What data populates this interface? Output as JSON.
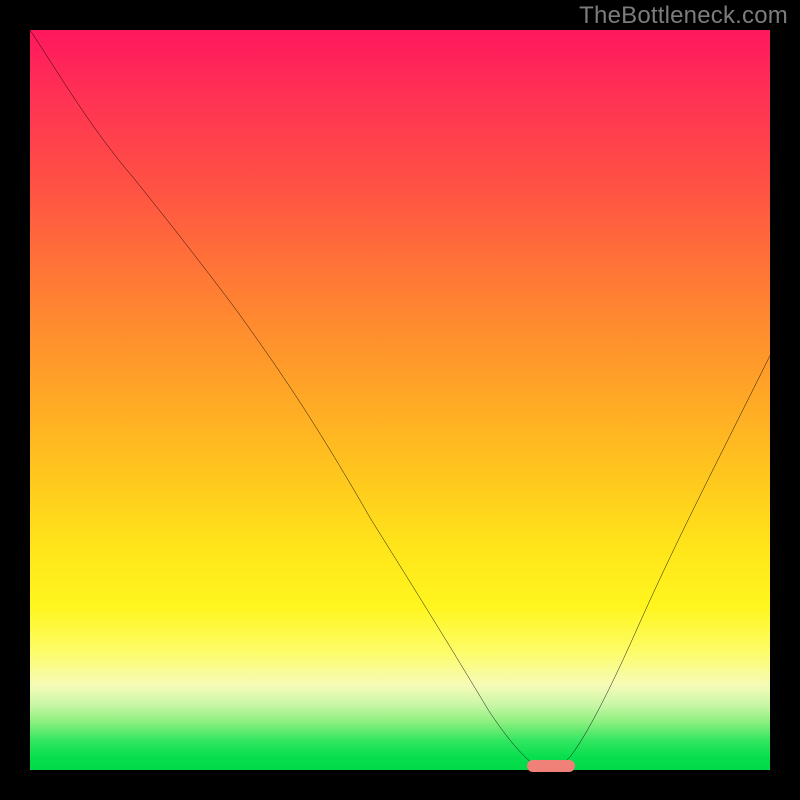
{
  "watermark": "TheBottleneck.com",
  "colors": {
    "background": "#000000",
    "curve": "#000000",
    "marker": "#f08178",
    "gradient_top": "#ff185e",
    "gradient_bottom": "#00d948"
  },
  "chart_data": {
    "type": "line",
    "title": "",
    "xlabel": "",
    "ylabel": "",
    "xlim": [
      0,
      100
    ],
    "ylim": [
      0,
      100
    ],
    "grid": false,
    "legend": false,
    "annotations": [
      {
        "kind": "watermark",
        "text": "TheBottleneck.com",
        "position": "top-right"
      }
    ],
    "series": [
      {
        "name": "bottleneck-curve",
        "x": [
          0,
          6,
          14,
          22,
          28,
          34,
          40,
          46,
          52,
          58,
          62,
          65,
          67,
          69,
          70.5,
          72,
          76,
          82,
          88,
          94,
          100
        ],
        "y": [
          100,
          90,
          80,
          70,
          62,
          53,
          44,
          34,
          24,
          14,
          8,
          4,
          2,
          0.6,
          0,
          0.8,
          7,
          19,
          32,
          44,
          56
        ]
      }
    ],
    "marker": {
      "name": "optimal-range",
      "x_start": 68,
      "x_end": 73,
      "y": 0,
      "color": "#f08178"
    }
  }
}
